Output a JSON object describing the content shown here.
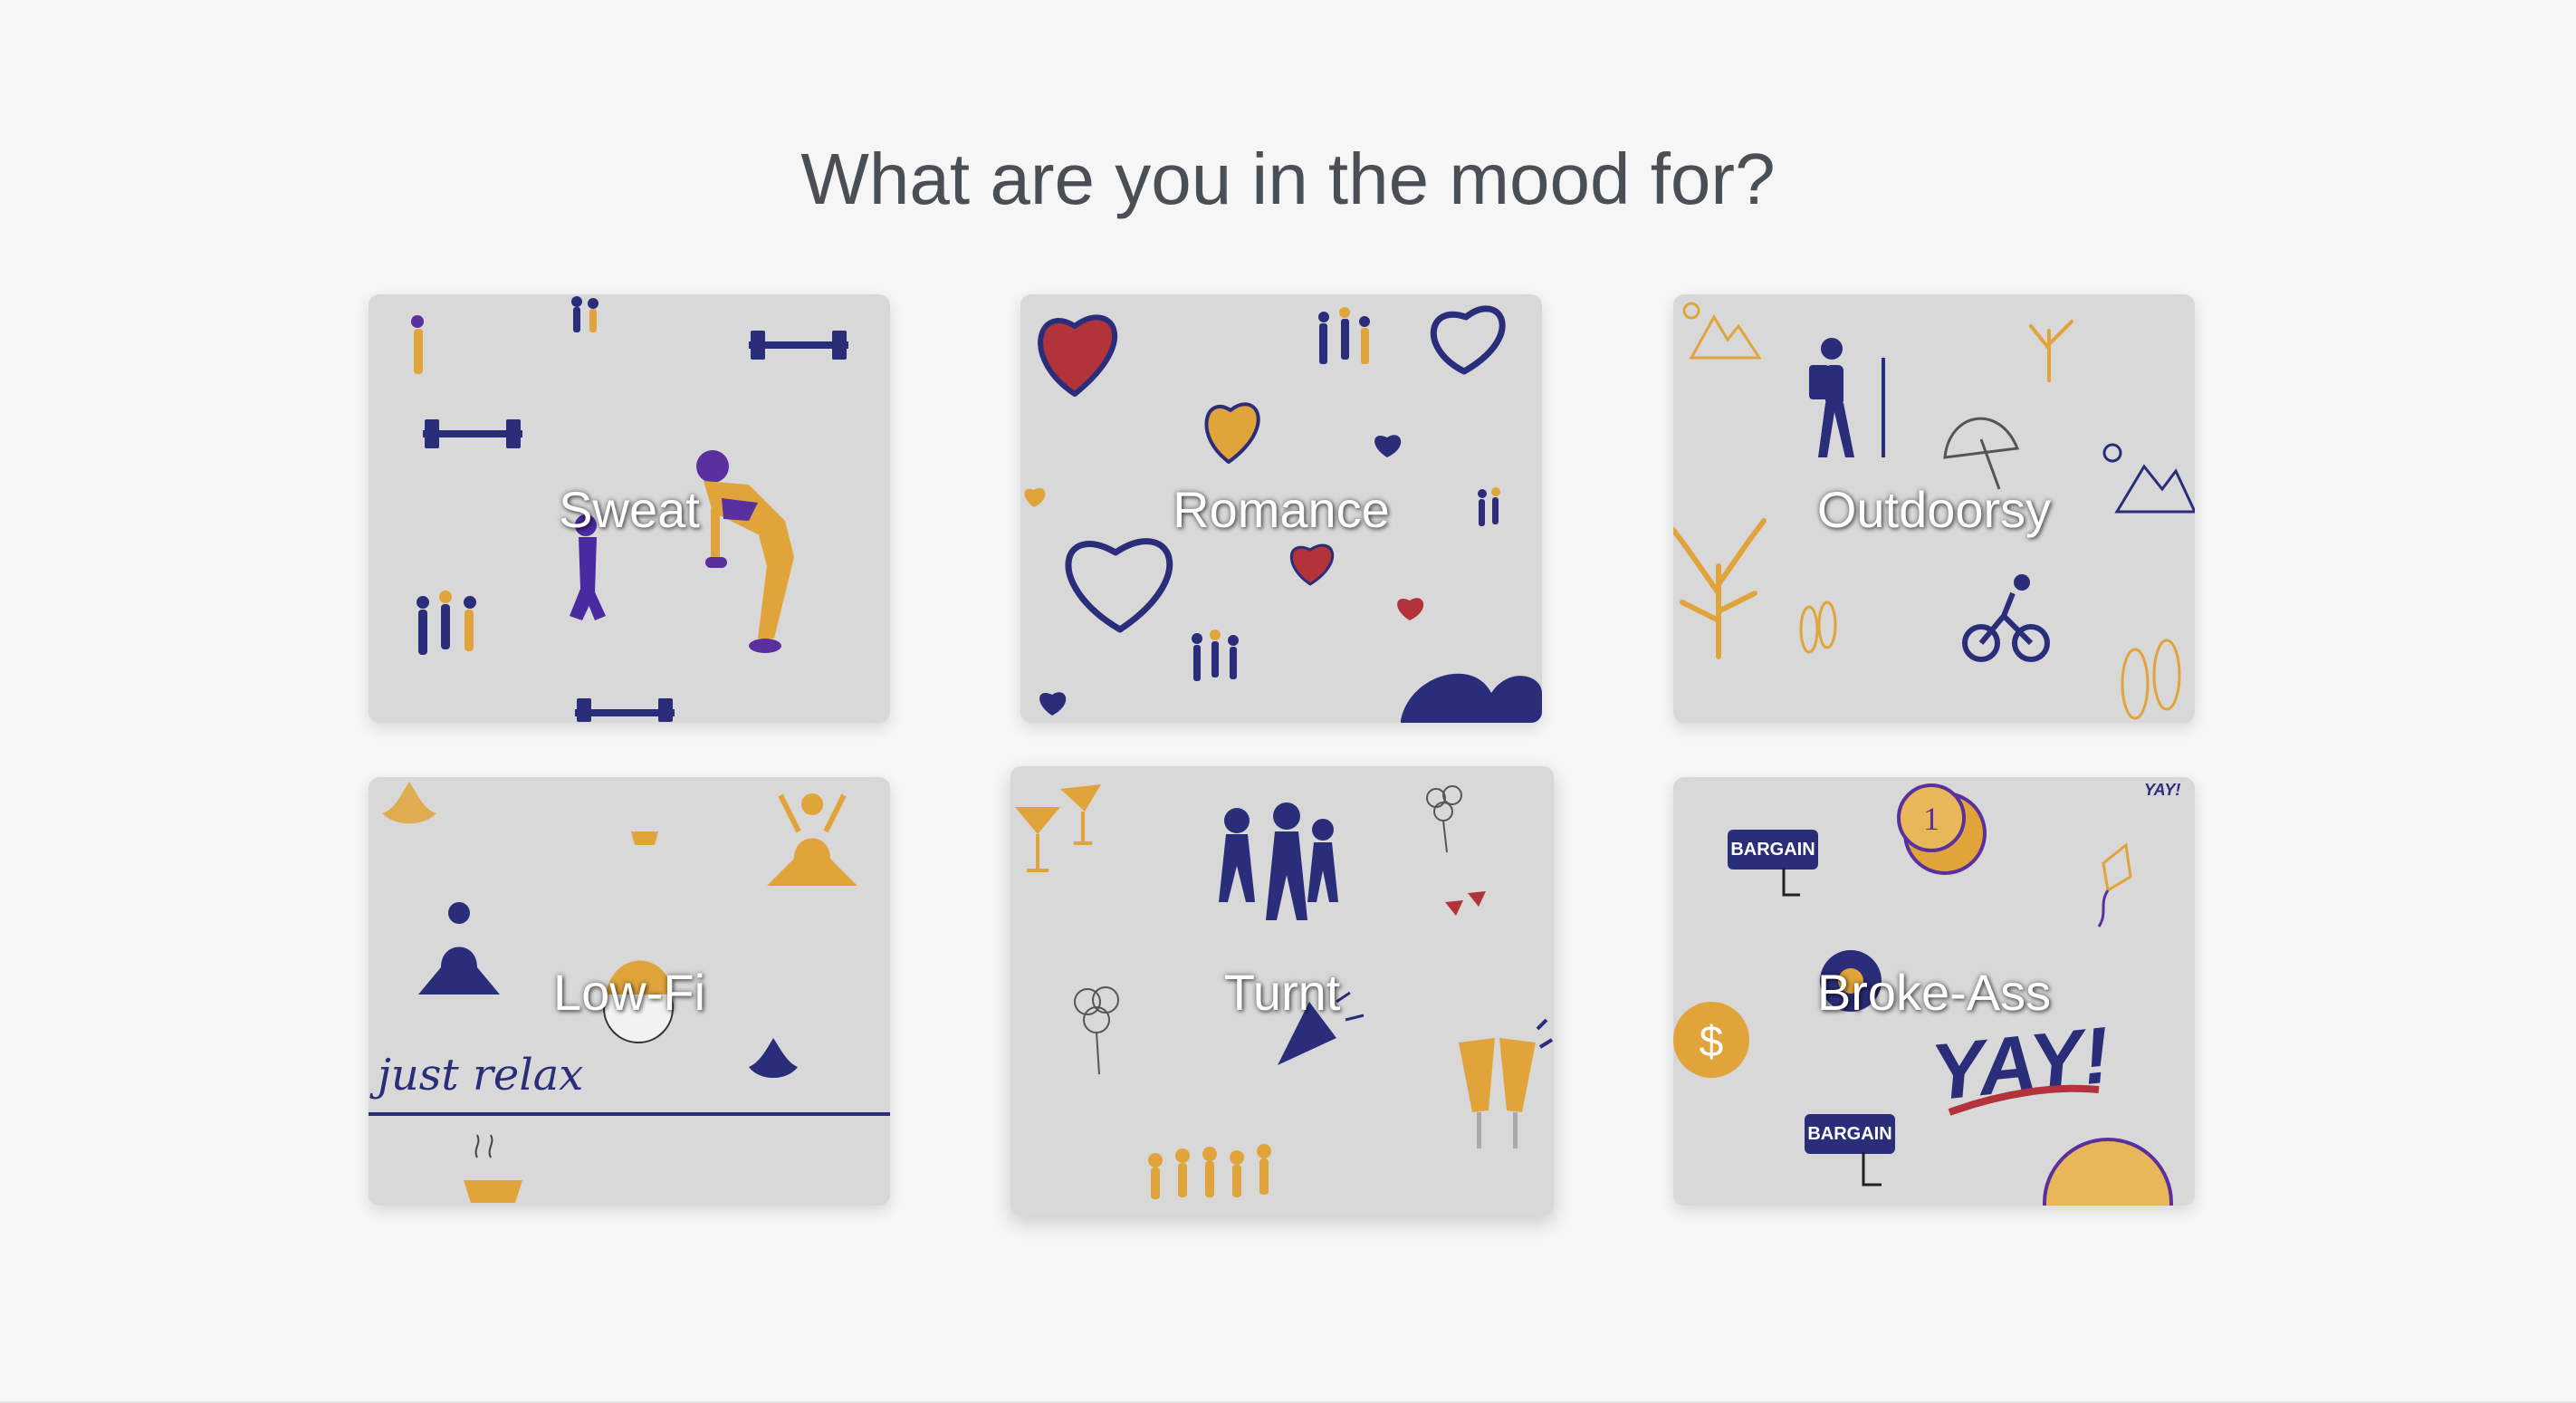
{
  "page": {
    "title": "What are you in the mood for?"
  },
  "moods": [
    {
      "label": "Sweat"
    },
    {
      "label": "Romance"
    },
    {
      "label": "Outdoorsy"
    },
    {
      "label": "Low-Fi"
    },
    {
      "label": "Turnt"
    },
    {
      "label": "Broke-Ass"
    }
  ],
  "illustration_text": {
    "relax_script": "just relax",
    "bargain_badge": "BARGAIN",
    "coin_number": "1",
    "dollar_symbol": "$",
    "yay": "YAY!"
  },
  "colors": {
    "navy": "#2a2d7a",
    "purple": "#5a2f9e",
    "gold": "#e0a43a",
    "red": "#b2333a",
    "card_bg": "#d8d8d8"
  }
}
